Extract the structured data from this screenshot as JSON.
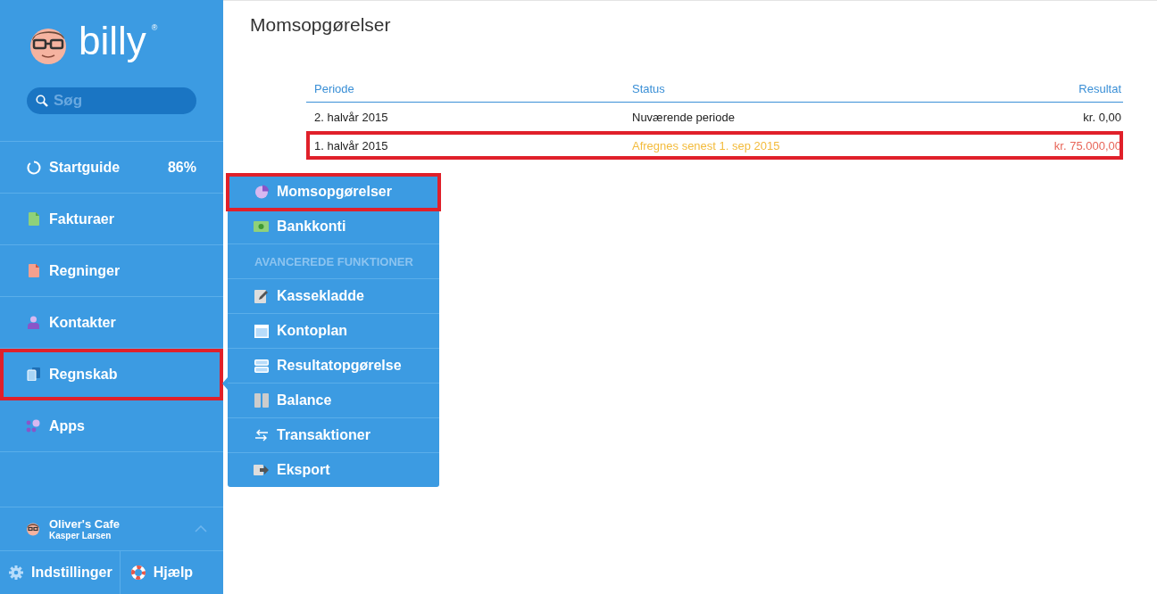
{
  "sidebar": {
    "logo_text": "billy",
    "logo_mark": "®",
    "search": {
      "placeholder": "Søg"
    },
    "items": [
      {
        "label": "Startguide",
        "badge": "86%",
        "highlighted": false
      },
      {
        "label": "Fakturaer",
        "highlighted": false
      },
      {
        "label": "Regninger",
        "highlighted": false
      },
      {
        "label": "Kontakter",
        "highlighted": false
      },
      {
        "label": "Regnskab",
        "highlighted": true
      },
      {
        "label": "Apps",
        "highlighted": false
      }
    ],
    "account": {
      "company": "Oliver's Cafe",
      "user": "Kasper Larsen",
      "expanded": false
    },
    "footer": [
      {
        "label": "Indstillinger"
      },
      {
        "label": "Hjælp"
      }
    ]
  },
  "submenu": {
    "items": [
      {
        "kind": "link",
        "label": "Momsopgørelser",
        "highlighted": true
      },
      {
        "kind": "link",
        "label": "Bankkonti",
        "highlighted": false
      },
      {
        "kind": "heading",
        "label": "AVANCEREDE FUNKTIONER"
      },
      {
        "kind": "link",
        "label": "Kassekladde",
        "highlighted": false
      },
      {
        "kind": "link",
        "label": "Kontoplan",
        "highlighted": false
      },
      {
        "kind": "link",
        "label": "Resultatopgørelse",
        "highlighted": false
      },
      {
        "kind": "link",
        "label": "Balance",
        "highlighted": false
      },
      {
        "kind": "link",
        "label": "Transaktioner",
        "highlighted": false
      },
      {
        "kind": "link",
        "label": "Eksport",
        "highlighted": false
      }
    ]
  },
  "page": {
    "title": "Momsopgørelser",
    "table": {
      "columns": [
        "Periode",
        "Status",
        "Resultat"
      ],
      "rows": [
        {
          "kind": "current",
          "highlighted": false,
          "cells": [
            "2. halvår 2015",
            "Nuværende periode",
            "kr. 0,00"
          ]
        },
        {
          "kind": "due",
          "highlighted": true,
          "cells": [
            "1. halvår 2015",
            "Afregnes senest 1. sep 2015",
            "kr. 75.000,00"
          ]
        }
      ]
    }
  }
}
